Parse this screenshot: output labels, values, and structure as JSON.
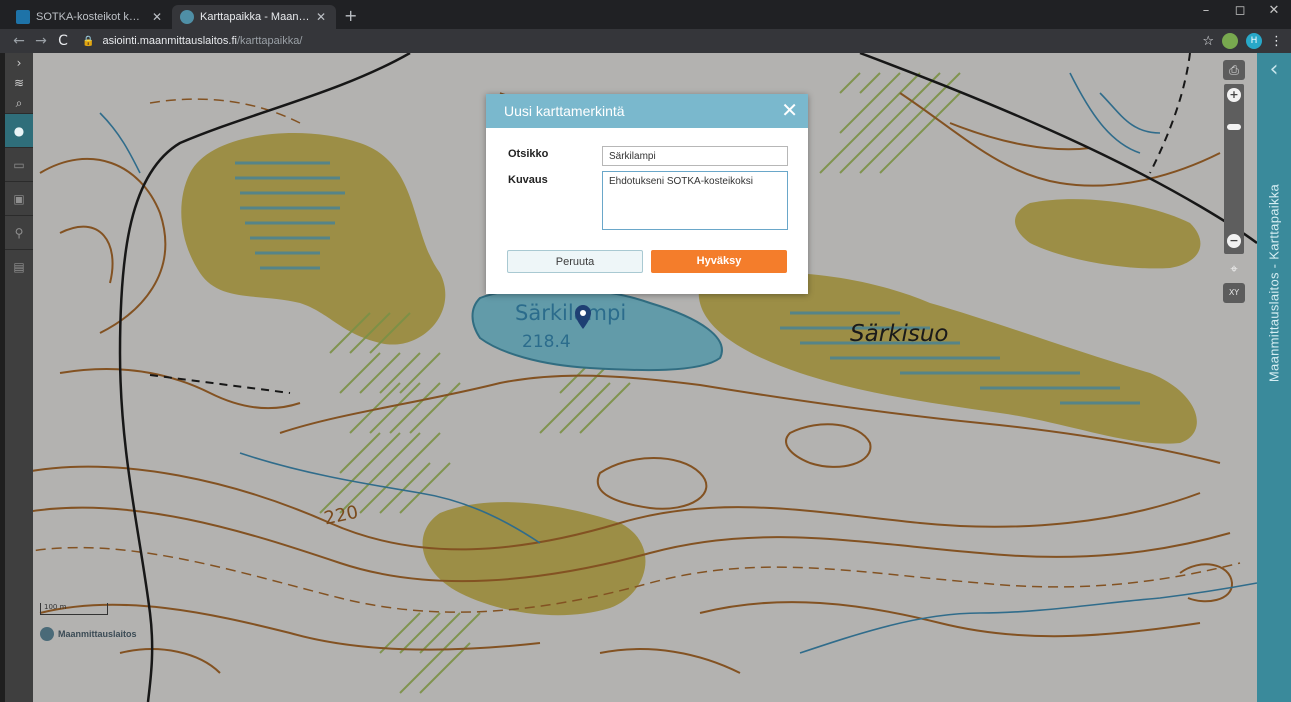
{
  "browser": {
    "tabs": [
      {
        "title": "SOTKA-kosteikot kohde-esitys - ",
        "active": false
      },
      {
        "title": "Karttapaikka - Maanmittauslaitos",
        "active": true
      }
    ],
    "new_tab": "+",
    "window_controls": [
      "–",
      "◻",
      "✕"
    ],
    "url_host": "asiointi.maanmittauslaitos.fi",
    "url_path": "/karttapaikka/",
    "profile_initial": "H"
  },
  "app": {
    "side_panel_title": "Maanmittauslaitos - Karttapaikka",
    "scale_label": "100 m",
    "logo_text": "Maanmittauslaitos"
  },
  "map_labels": {
    "lake_name": "Särkilampi",
    "lake_elevation": "218.4",
    "bog_name": "Särkisuo",
    "contour_label": "220"
  },
  "dialog": {
    "title": "Uusi karttamerkintä",
    "title_label": "Otsikko",
    "title_value": "Särkilampi",
    "description_label": "Kuvaus",
    "description_value": "Ehdotukseni SOTKA-kosteikoksi",
    "cancel_label": "Peruuta",
    "accept_label": "Hyväksy"
  },
  "colors": {
    "dialog_header": "#7ab8cd",
    "accept_button": "#f47d2b",
    "side_panel": "#3a8a9b"
  }
}
